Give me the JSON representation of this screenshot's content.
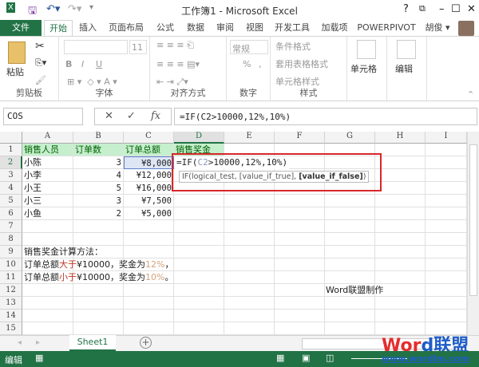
{
  "title": "工作簿1 - Microsoft Excel",
  "title_buttons": {
    "help": "?",
    "restore": "⧉",
    "minimize": "–",
    "maximize": "☐",
    "close": "✕"
  },
  "tabs": [
    "文件",
    "开始",
    "插入",
    "页面布局",
    "公式",
    "数据",
    "审阅",
    "视图",
    "开发工具",
    "加载项",
    "POWERPIVOT"
  ],
  "user": "胡俊 ▾",
  "ribbon": {
    "clipboard": {
      "paste": "粘贴",
      "label": "剪贴板"
    },
    "font": {
      "size": "11",
      "bold": "B",
      "italic": "I",
      "underline": "U",
      "label": "字体"
    },
    "align": {
      "label": "对齐方式"
    },
    "number": {
      "format": "常规",
      "percent": "%",
      "comma": ",",
      "label": "数字"
    },
    "styles": {
      "cond": "条件格式",
      "table": "套用表格格式",
      "cell": "单元格样式",
      "label": "样式"
    },
    "cells": {
      "label": "单元格"
    },
    "edit": {
      "label": "编辑"
    }
  },
  "namebox": "COS",
  "formula": "=IF(C2>10000,12%,10%)",
  "formula_icons": {
    "cancel": "✕",
    "enter": "✓",
    "fx": "fx"
  },
  "columns": [
    "A",
    "B",
    "C",
    "D",
    "E",
    "F",
    "G",
    "H",
    "I"
  ],
  "rows": [
    "1",
    "2",
    "3",
    "4",
    "5",
    "6",
    "7",
    "8",
    "9",
    "10",
    "11",
    "12",
    "13",
    "14",
    "15"
  ],
  "headers": [
    "销售人员",
    "订单数",
    "订单总额",
    "销售奖金"
  ],
  "data": [
    [
      "小陈",
      "3",
      "¥8,000"
    ],
    [
      "小李",
      "4",
      "¥12,000"
    ],
    [
      "小王",
      "5",
      "¥16,000"
    ],
    [
      "小三",
      "3",
      "¥7,500"
    ],
    [
      "小鱼",
      "2",
      "¥5,000"
    ]
  ],
  "edit_cell": {
    "pre": "=IF(",
    "ref": "C2",
    "post": ">10000,12%,10%)"
  },
  "tooltip": {
    "pre": "IF(logical_test, [value_if_true], ",
    "bold": "[value_if_false]",
    "post": ")"
  },
  "notes": {
    "title": "销售奖金计算方法：",
    "l1": [
      "订单总额",
      "大于",
      "¥10000，奖金为",
      "12%",
      "，"
    ],
    "l2": [
      "订单总额",
      "小于",
      "¥10000，奖金为",
      "10%",
      "。"
    ],
    "credit": "Word联盟制作"
  },
  "sheet_tab": "Sheet1",
  "add_sheet": "+",
  "status": "编辑",
  "watermark": {
    "brand": "Word联盟",
    "url": "www.wordlm.com"
  },
  "colors": {
    "excel_green": "#217346",
    "red_box": "#d9262b",
    "header_fill": "#c6efce"
  }
}
